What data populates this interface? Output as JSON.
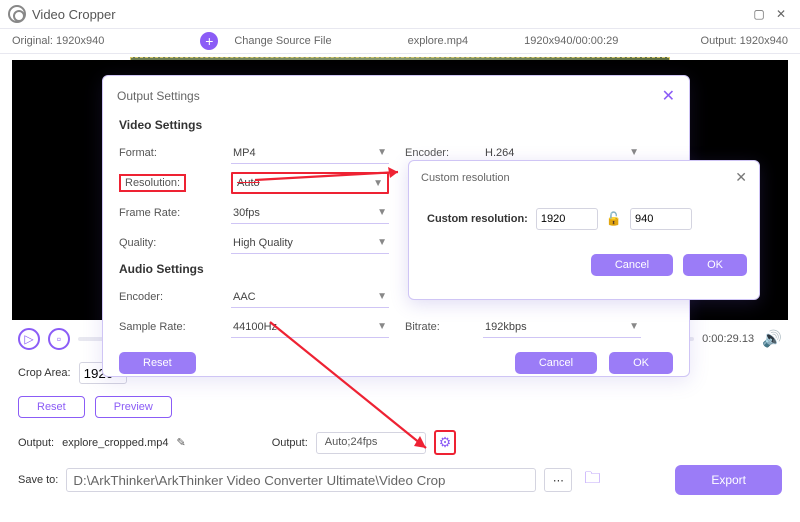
{
  "app": {
    "title": "Video Cropper"
  },
  "infobar": {
    "original": "Original: 1920x940",
    "change_source": "Change Source File",
    "filename": "explore.mp4",
    "dims_time": "1920x940/00:00:29",
    "output": "Output: 1920x940"
  },
  "controls": {
    "time": "0:00:29.13"
  },
  "croprow": {
    "label": "Crop Area:",
    "w": "1920"
  },
  "btnrow": {
    "reset": "Reset",
    "preview": "Preview"
  },
  "outrow": {
    "label1": "Output:",
    "filename": "explore_cropped.mp4",
    "label2": "Output:",
    "value": "Auto;24fps"
  },
  "saverow": {
    "label": "Save to:",
    "path": "D:\\ArkThinker\\ArkThinker Video Converter Ultimate\\Video Crop",
    "export": "Export"
  },
  "dialog1": {
    "title": "Output Settings",
    "video_section": "Video Settings",
    "audio_section": "Audio Settings",
    "rows": {
      "format_l": "Format:",
      "format_v": "MP4",
      "encoder_l": "Encoder:",
      "encoder_v": "H.264",
      "resolution_l": "Resolution:",
      "resolution_v": "Auto",
      "framerate_l": "Frame Rate:",
      "framerate_v": "30fps",
      "quality_l": "Quality:",
      "quality_v": "High Quality",
      "aencoder_l": "Encoder:",
      "aencoder_v": "AAC",
      "sample_l": "Sample Rate:",
      "sample_v": "44100Hz",
      "bitrate_l": "Bitrate:",
      "bitrate_v": "192kbps"
    },
    "reset": "Reset",
    "cancel": "Cancel",
    "ok": "OK"
  },
  "dialog2": {
    "title": "Custom resolution",
    "label": "Custom resolution:",
    "w": "1920",
    "h": "940",
    "cancel": "Cancel",
    "ok": "OK"
  }
}
